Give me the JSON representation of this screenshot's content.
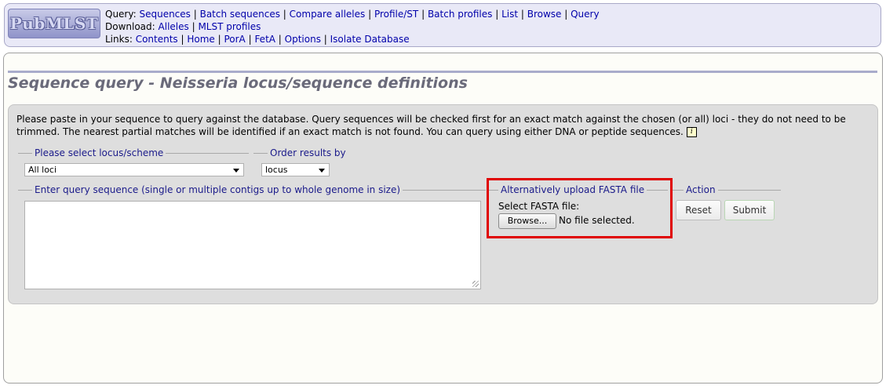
{
  "header": {
    "logo_text": "PubMLST",
    "query_label": "Query:",
    "query_links": [
      "Sequences",
      "Batch sequences",
      "Compare alleles",
      "Profile/ST",
      "Batch profiles",
      "List",
      "Browse",
      "Query"
    ],
    "download_label": "Download:",
    "download_links": [
      "Alleles",
      "MLST profiles"
    ],
    "links_label": "Links:",
    "links_links": [
      "Contents",
      "Home",
      "PorA",
      "FetA",
      "Options",
      "Isolate Database"
    ]
  },
  "page": {
    "title": "Sequence query - Neisseria locus/sequence definitions",
    "intro": "Please paste in your sequence to query against the database. Query sequences will be checked first for an exact match against the chosen (or all) loci - they do not need to be trimmed. The nearest partial matches will be identified if an exact match is not found. You can query using either DNA or peptide sequences.",
    "info_icon_text": "i"
  },
  "form": {
    "locus_legend": "Please select locus/scheme",
    "locus_value": "All loci",
    "order_legend": "Order results by",
    "order_value": "locus",
    "sequence_legend": "Enter query sequence (single or multiple contigs up to whole genome in size)",
    "sequence_value": "",
    "fasta_legend": "Alternatively upload FASTA file",
    "fasta_label": "Select FASTA file:",
    "browse_label": "Browse...",
    "no_file_text": "No file selected.",
    "action_legend": "Action",
    "reset_label": "Reset",
    "submit_label": "Submit"
  },
  "colors": {
    "highlight": "#e00000",
    "link": "#0000aa",
    "legend_text": "#1a1a8a"
  }
}
